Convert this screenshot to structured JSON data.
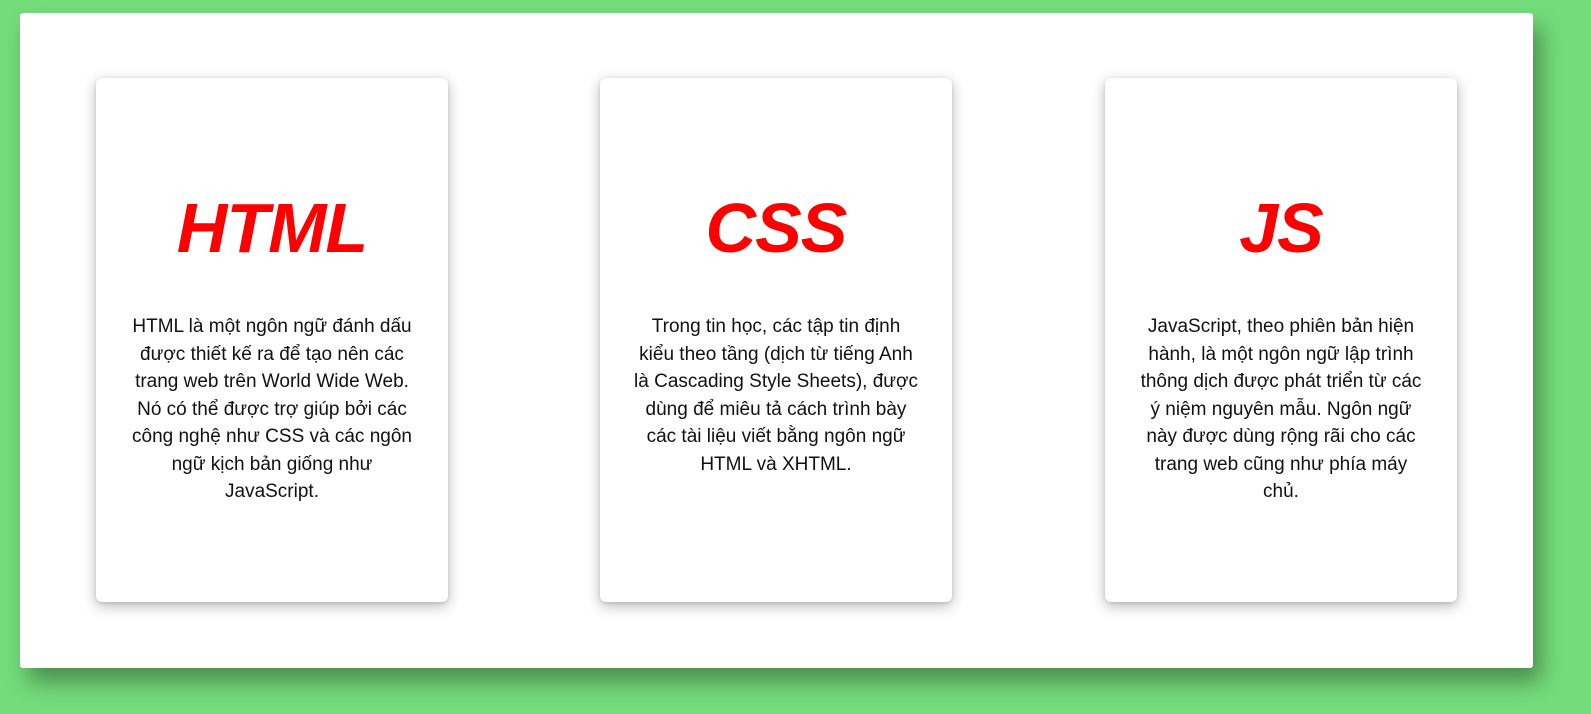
{
  "colors": {
    "background": "#74dc7a",
    "panel": "#ffffff",
    "title_accent": "#ff0000",
    "body_text": "#111111"
  },
  "cards": [
    {
      "title": "HTML",
      "text": "HTML là một ngôn ngữ đánh dấu được thiết kế ra để tạo nên các trang web trên World Wide Web. Nó có thể được trợ giúp bởi các công nghệ như CSS và các ngôn ngữ kịch bản giống như JavaScript."
    },
    {
      "title": "CSS",
      "text": "Trong tin học, các tập tin định kiểu theo tầng (dịch từ tiếng Anh là Cascading Style Sheets), được dùng để miêu tả cách trình bày các tài liệu viết bằng ngôn ngữ HTML và XHTML."
    },
    {
      "title": "JS",
      "text": "JavaScript, theo phiên bản hiện hành, là một ngôn ngữ lập trình thông dịch được phát triển từ các ý niệm nguyên mẫu. Ngôn ngữ này được dùng rộng rãi cho các trang web cũng như phía máy chủ."
    }
  ]
}
